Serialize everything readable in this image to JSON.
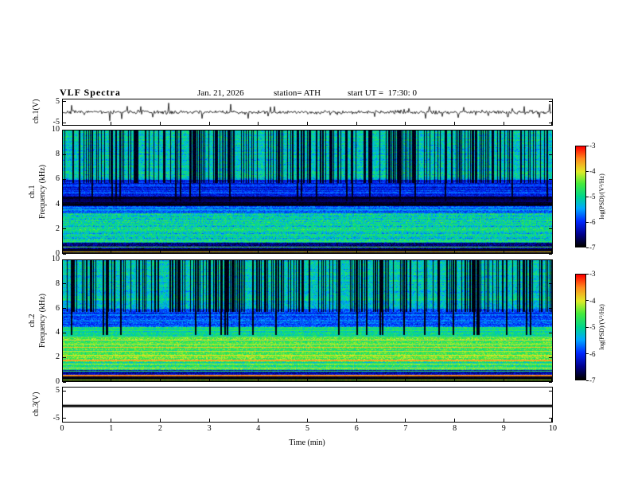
{
  "header": {
    "title": "VLF Spectra",
    "date": "Jan. 21, 2026",
    "station": "station= ATH",
    "start_ut": "start UT =  17:30: 0"
  },
  "axes": {
    "x_label": "Time  (min)",
    "x_ticks": [
      0,
      1,
      2,
      3,
      4,
      5,
      6,
      7,
      8,
      9,
      10
    ],
    "x_range": [
      0,
      10
    ]
  },
  "panels": {
    "waveform_ch1": {
      "label": "ch.1(V)",
      "y_ticks": [
        5,
        -5
      ],
      "y_range": [
        -6.5,
        6.5
      ]
    },
    "spec_ch1": {
      "label_channel": "ch.1",
      "label_axis": "Frequency  (kHz)",
      "y_ticks": [
        0,
        2,
        4,
        6,
        8,
        10
      ],
      "y_range": [
        0,
        10
      ]
    },
    "spec_ch2": {
      "label_channel": "ch.2",
      "label_axis": "Frequency  (kHz)",
      "y_ticks": [
        0,
        2,
        4,
        6,
        8,
        10
      ],
      "y_range": [
        0,
        10
      ]
    },
    "waveform_ch3": {
      "label": "ch.3(V)",
      "y_ticks": [
        5,
        -5
      ],
      "y_range": [
        -6.5,
        6.5
      ]
    }
  },
  "colorbar": {
    "label": "log(PSD)/(V²/Hz)",
    "ticks": [
      -3,
      -4,
      -5,
      -6,
      -7
    ],
    "range": [
      -7,
      -3
    ],
    "colormap": [
      {
        "t": 0.0,
        "rgb": [
          0,
          0,
          0
        ]
      },
      {
        "t": 0.12,
        "rgb": [
          0,
          0,
          140
        ]
      },
      {
        "t": 0.25,
        "rgb": [
          0,
          40,
          255
        ]
      },
      {
        "t": 0.38,
        "rgb": [
          0,
          170,
          255
        ]
      },
      {
        "t": 0.5,
        "rgb": [
          0,
          215,
          140
        ]
      },
      {
        "t": 0.63,
        "rgb": [
          70,
          235,
          60
        ]
      },
      {
        "t": 0.75,
        "rgb": [
          225,
          235,
          40
        ]
      },
      {
        "t": 0.88,
        "rgb": [
          255,
          140,
          30
        ]
      },
      {
        "t": 1.0,
        "rgb": [
          255,
          0,
          0
        ]
      }
    ]
  },
  "chart_data": [
    {
      "type": "line",
      "name": "ch.1 voltage waveform",
      "ylabel": "ch.1(V)",
      "x_range": [
        0,
        10
      ],
      "y_range": [
        -6.5,
        6.5
      ],
      "baseline": 0,
      "noise_sigma": 0.45,
      "spike_probability": 0.05,
      "spike_amplitude": 3.2,
      "description": "Noisy trace centred on 0 V with frequent impulsive spikes reaching about ±4 V over the 10-minute record"
    },
    {
      "type": "heatmap",
      "name": "ch.1 VLF spectrogram",
      "ylabel": "ch.1 Frequency (kHz)",
      "zlabel": "log(PSD)/(V²/Hz)",
      "x_range": [
        0,
        10
      ],
      "y_range": [
        0,
        10
      ],
      "z_range": [
        -7,
        -3
      ],
      "bands": [
        {
          "f": [
            0,
            0.3
          ],
          "v": -6.95,
          "n": 0.08
        },
        {
          "f": [
            0.3,
            0.85
          ],
          "v": -6.5,
          "n": 0.35
        },
        {
          "f": [
            0.85,
            3.25
          ],
          "v": -5.1,
          "n": 0.55
        },
        {
          "f": [
            3.25,
            3.85
          ],
          "v": -5.8,
          "n": 0.35
        },
        {
          "f": [
            3.85,
            4.6
          ],
          "v": -6.85,
          "n": 0.12
        },
        {
          "f": [
            4.6,
            6.0
          ],
          "v": -6.15,
          "n": 0.3
        },
        {
          "f": [
            6.0,
            10.01
          ],
          "v": -5.15,
          "n": 0.45
        }
      ],
      "hlines": [
        {
          "f": 0.15,
          "v": -3.8,
          "w": 1
        },
        {
          "f": 0.5,
          "v": -4.4,
          "w": 1
        },
        {
          "f": 0.95,
          "v": -4.7,
          "w": 1
        },
        {
          "f": 1.4,
          "v": -4.9,
          "w": 1
        },
        {
          "f": 1.9,
          "v": -4.8,
          "w": 1
        },
        {
          "f": 2.4,
          "v": -5.0,
          "w": 1
        },
        {
          "f": 2.9,
          "v": -4.9,
          "w": 1
        },
        {
          "f": 3.6,
          "v": -5.3,
          "w": 1
        },
        {
          "f": 4.95,
          "v": -5.7,
          "w": 1
        },
        {
          "f": 5.5,
          "v": -5.8,
          "w": 1
        }
      ],
      "streaks": {
        "count": 210,
        "fmin": 5.7,
        "v": -6.9,
        "deep_count": 22,
        "deep_fmin": 4.2
      },
      "description": "Green speckled sferic band above 6 kHz cut by dense black vertical impulses, blue band 4.6-6 kHz, black depleted band 3.9-4.6 kHz, mottled cyan-green 1-3.2 kHz with faint horizontal lines, black band below 0.8 kHz"
    },
    {
      "type": "heatmap",
      "name": "ch.2 VLF spectrogram",
      "ylabel": "ch.2 Frequency (kHz)",
      "zlabel": "log(PSD)/(V²/Hz)",
      "x_range": [
        0,
        10
      ],
      "y_range": [
        0,
        10
      ],
      "z_range": [
        -7,
        -3
      ],
      "bands": [
        {
          "f": [
            0,
            0.45
          ],
          "v": -6.9,
          "n": 0.1
        },
        {
          "f": [
            0.45,
            0.95
          ],
          "v": -6.3,
          "n": 0.3
        },
        {
          "f": [
            0.95,
            1.6
          ],
          "v": -4.9,
          "n": 0.5
        },
        {
          "f": [
            1.6,
            2.1
          ],
          "v": -4.4,
          "n": 0.45
        },
        {
          "f": [
            2.1,
            3.6
          ],
          "v": -4.6,
          "n": 0.45
        },
        {
          "f": [
            3.6,
            4.45
          ],
          "v": -5.0,
          "n": 0.4
        },
        {
          "f": [
            4.45,
            6.0
          ],
          "v": -5.9,
          "n": 0.35
        },
        {
          "f": [
            6.0,
            10.01
          ],
          "v": -5.15,
          "n": 0.45
        }
      ],
      "hlines": [
        {
          "f": 0.12,
          "v": -4.2,
          "w": 1
        },
        {
          "f": 0.55,
          "v": -3.5,
          "w": 2
        },
        {
          "f": 0.85,
          "v": -4.6,
          "w": 1
        },
        {
          "f": 1.15,
          "v": -4.0,
          "w": 1
        },
        {
          "f": 1.45,
          "v": -4.15,
          "w": 1
        },
        {
          "f": 1.8,
          "v": -3.6,
          "w": 2
        },
        {
          "f": 2.15,
          "v": -3.9,
          "w": 1
        },
        {
          "f": 2.5,
          "v": -4.0,
          "w": 1
        },
        {
          "f": 2.8,
          "v": -3.75,
          "w": 1
        },
        {
          "f": 3.1,
          "v": -4.0,
          "w": 1
        },
        {
          "f": 3.4,
          "v": -3.9,
          "w": 1
        },
        {
          "f": 3.7,
          "v": -4.3,
          "w": 1
        },
        {
          "f": 4.2,
          "v": -4.6,
          "w": 1
        },
        {
          "f": 5.0,
          "v": -5.5,
          "w": 1
        },
        {
          "f": 5.5,
          "v": -5.6,
          "w": 1
        }
      ],
      "streaks": {
        "count": 230,
        "fmin": 5.7,
        "v": -6.95,
        "deep_count": 28,
        "deep_fmin": 3.8
      },
      "description": "Bright green-yellow harmonic line band 1-3.6 kHz with orange/red lines near 0.55 and 1.8 kHz, blue band 4.5-6 kHz, green sferic band above 6 kHz with heavy black vertical impulses, black band below 0.5 kHz"
    },
    {
      "type": "line",
      "name": "ch.3 voltage waveform",
      "ylabel": "ch.3(V)",
      "x_range": [
        0,
        10
      ],
      "y_range": [
        -6.5,
        6.5
      ],
      "constant_value": -0.5,
      "line_width": 3,
      "description": "Flat thick black trace at a constant level just below 0 V (dead/saturated channel)"
    }
  ]
}
